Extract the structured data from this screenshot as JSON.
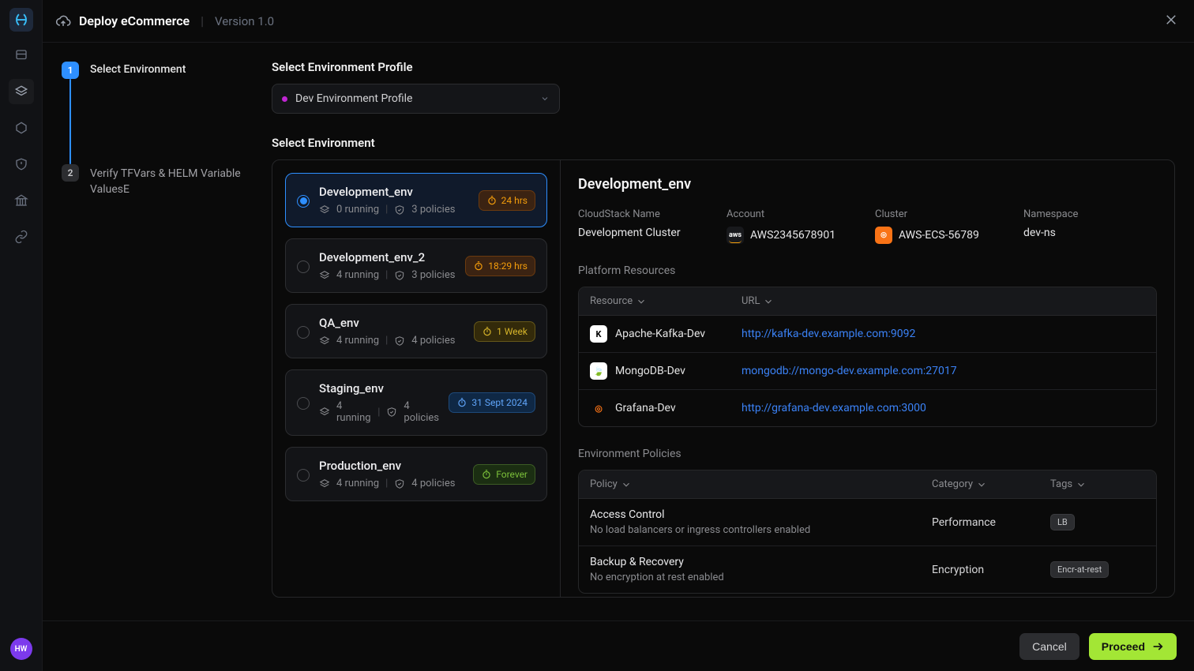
{
  "header": {
    "title": "Deploy eCommerce",
    "version": "Version 1.0"
  },
  "rail": {
    "avatar": "HW"
  },
  "stepper": {
    "step1": {
      "num": "1",
      "label": "Select Environment"
    },
    "step2": {
      "num": "2",
      "label": "Verify TFVars & HELM  Variable ValuesE"
    }
  },
  "profile": {
    "section_label": "Select Environment Profile",
    "value": "Dev Environment Profile"
  },
  "env_section_label": "Select Environment",
  "environments": [
    {
      "name": "Development_env",
      "running": "0 running",
      "policies": "3 policies",
      "ttl": "24 hrs",
      "ttl_variant": "orange",
      "selected": true
    },
    {
      "name": "Development_env_2",
      "running": "4 running",
      "policies": "3 policies",
      "ttl": "18:29 hrs",
      "ttl_variant": "orange",
      "selected": false
    },
    {
      "name": "QA_env",
      "running": "4 running",
      "policies": "4 policies",
      "ttl": "1 Week",
      "ttl_variant": "yellow",
      "selected": false
    },
    {
      "name": "Staging_env",
      "running": "4 running",
      "policies": "4 policies",
      "ttl": "31 Sept 2024",
      "ttl_variant": "blue",
      "selected": false
    },
    {
      "name": "Production_env",
      "running": "4 running",
      "policies": "4 policies",
      "ttl": "Forever",
      "ttl_variant": "green",
      "selected": false
    }
  ],
  "details": {
    "title": "Development_env",
    "cloudstack_label": "CloudStack Name",
    "cloudstack_value": "Development Cluster",
    "account_label": "Account",
    "account_value": "AWS2345678901",
    "cluster_label": "Cluster",
    "cluster_value": "AWS-ECS-56789",
    "namespace_label": "Namespace",
    "namespace_value": "dev-ns",
    "resources_label": "Platform Resources",
    "resources_th_resource": "Resource",
    "resources_th_url": "URL",
    "resources": [
      {
        "icon": "kafka",
        "name": "Apache-Kafka-Dev",
        "url": "http://kafka-dev.example.com:9092"
      },
      {
        "icon": "mongo",
        "name": "MongoDB-Dev",
        "url": "mongodb://mongo-dev.example.com:27017"
      },
      {
        "icon": "grafana",
        "name": "Grafana-Dev",
        "url": "http://grafana-dev.example.com:3000"
      }
    ],
    "policies_label": "Environment Policies",
    "policies_th_policy": "Policy",
    "policies_th_category": "Category",
    "policies_th_tags": "Tags",
    "policies": [
      {
        "name": "Access Control",
        "desc": "No load balancers or ingress controllers enabled",
        "category": "Performance",
        "tag": "LB"
      },
      {
        "name": "Backup & Recovery",
        "desc": "No encryption at rest enabled",
        "category": "Encryption",
        "tag": "Encr-at-rest"
      }
    ]
  },
  "footer": {
    "cancel": "Cancel",
    "proceed": "Proceed"
  }
}
